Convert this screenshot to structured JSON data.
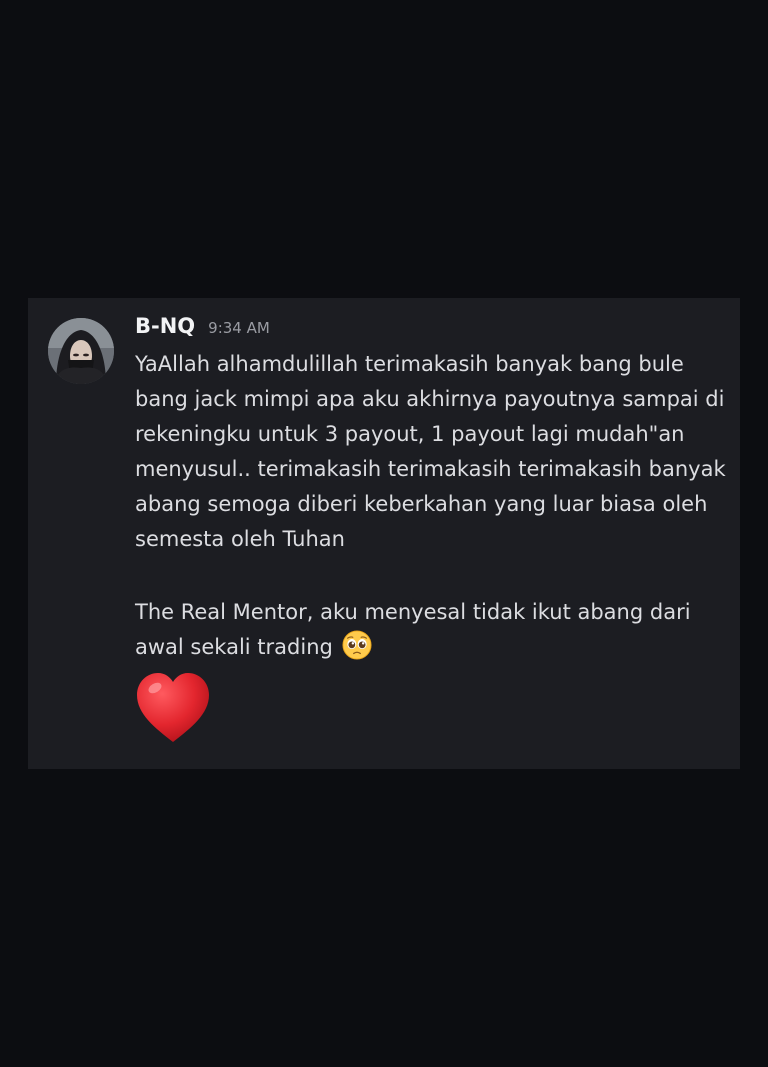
{
  "message": {
    "username": "B-NQ",
    "timestamp": "9:34 AM",
    "avatar_icon": "avatar-woman-hooded-icon",
    "lines": [
      "YaAllah alhamdulillah terimakasih banyak bang bule bang jack mimpi apa aku akhirnya payoutnya sampai di rekeningku untuk 3 payout, 1 payout lagi mudah\"an menyusul.. terimakasih terimakasih terimakasih banyak abang semoga diberi keberkahan yang luar biasa oleh semesta oleh Tuhan",
      "The Real Mentor, aku menyesal tidak ikut abang dari awal sekali trading"
    ],
    "emoji_inline": "pleading-face-emoji",
    "emoji_big": "red-heart-emoji"
  },
  "colors": {
    "page_bg": "#0c0d11",
    "card_bg": "#1c1d22",
    "username": "#f2f3f5",
    "timestamp": "#9a9ca3",
    "text": "#dcdde1",
    "heart": "#e3262e"
  }
}
